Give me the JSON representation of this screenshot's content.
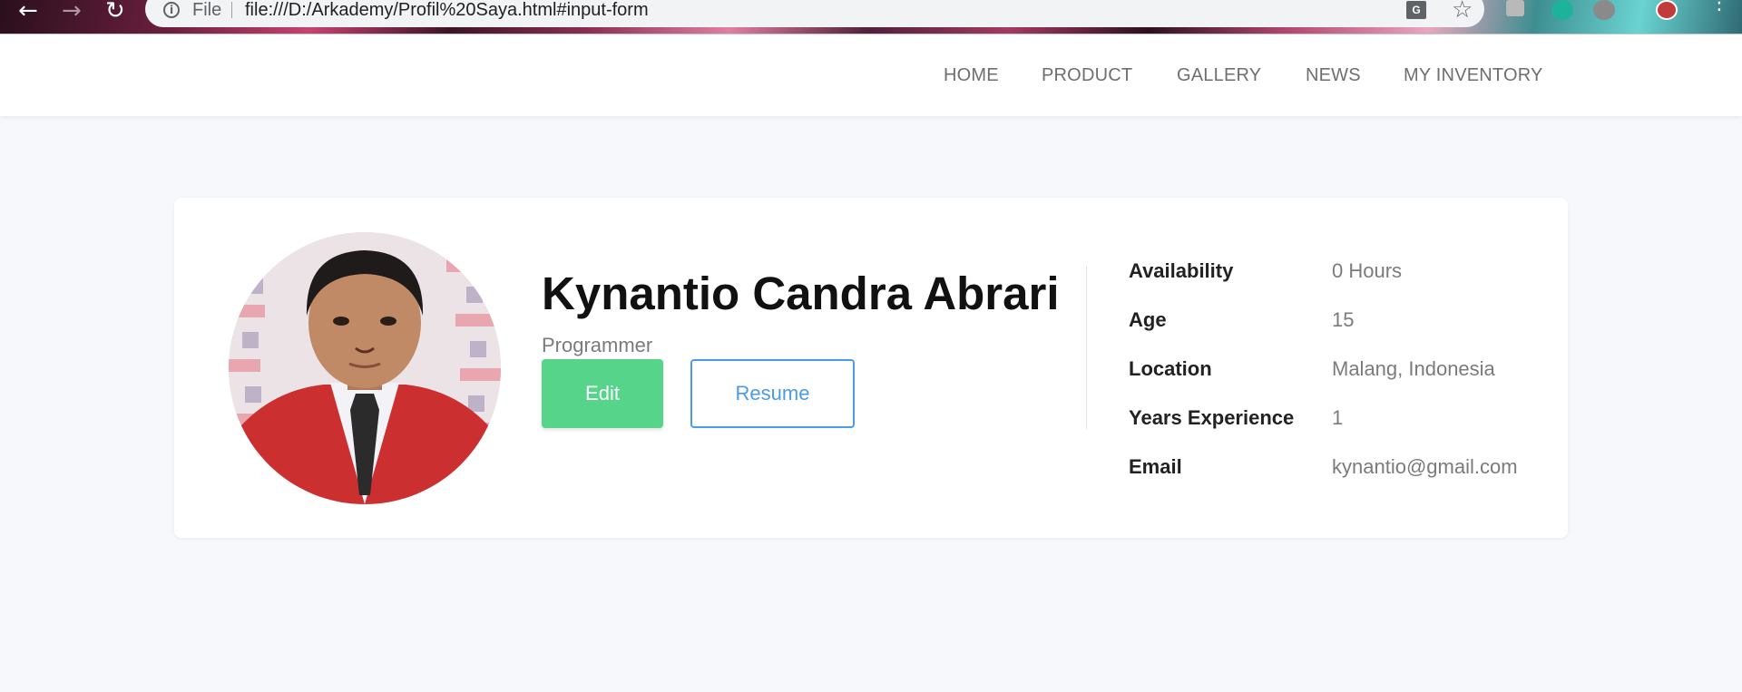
{
  "browser": {
    "back_glyph": "←",
    "forward_glyph": "→",
    "reload_glyph": "↻",
    "info_glyph": "i",
    "file_label": "File",
    "url": "file:///D:/Arkademy/Profil%20Saya.html#input-form",
    "translate_glyph": "G",
    "star_glyph": "☆",
    "menu_glyph": "⋮",
    "icons": [
      "back-icon",
      "forward-icon",
      "reload-icon",
      "info-icon",
      "translate-icon",
      "star-icon",
      "extension-icon",
      "profile-avatar-icon",
      "menu-icon"
    ]
  },
  "nav": {
    "items": [
      {
        "label": "HOME"
      },
      {
        "label": "PRODUCT"
      },
      {
        "label": "GALLERY"
      },
      {
        "label": "NEWS"
      },
      {
        "label": "MY INVENTORY"
      }
    ]
  },
  "profile": {
    "name": "Kynantio Candra Abrari",
    "role": "Programmer",
    "edit_label": "Edit",
    "resume_label": "Resume",
    "details": [
      {
        "label": "Availability",
        "value": "0 Hours"
      },
      {
        "label": "Age",
        "value": "15"
      },
      {
        "label": "Location",
        "value": "Malang, Indonesia"
      },
      {
        "label": "Years Experience",
        "value": "1"
      },
      {
        "label": "Email",
        "value": "kynantio@gmail.com"
      }
    ]
  },
  "colors": {
    "page_bg": "#f7f8fb",
    "edit_button": "#55d48a",
    "resume_accent": "#4a9be8",
    "nav_text": "#6e6e6e",
    "jacket_red": "#cc2f2f"
  }
}
